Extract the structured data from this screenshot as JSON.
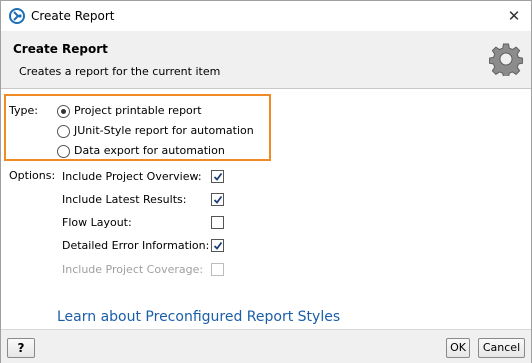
{
  "window": {
    "title": "Create Report",
    "close_glyph": "✕"
  },
  "banner": {
    "title": "Create Report",
    "subtitle": "Creates a report for the current item",
    "icon": "gear-icon"
  },
  "type": {
    "label": "Type:",
    "options": [
      {
        "label": "Project printable report",
        "selected": true
      },
      {
        "label": "JUnit-Style report for automation",
        "selected": false
      },
      {
        "label": "Data export for automation",
        "selected": false
      }
    ],
    "highlight_color": "#f08a24"
  },
  "options": {
    "label": "Options:",
    "items": [
      {
        "label": "Include Project Overview:",
        "checked": true,
        "enabled": true
      },
      {
        "label": "Include Latest Results:",
        "checked": true,
        "enabled": true
      },
      {
        "label": "Flow Layout:",
        "checked": false,
        "enabled": true
      },
      {
        "label": "Detailed Error Information:",
        "checked": true,
        "enabled": true
      },
      {
        "label": "Include Project Coverage:",
        "checked": false,
        "enabled": false
      }
    ]
  },
  "link": {
    "text": "Learn about Preconfigured Report Styles",
    "color": "#1a5ea8"
  },
  "footer": {
    "help_label": "?",
    "ok_label": "OK",
    "cancel_label": "Cancel"
  }
}
